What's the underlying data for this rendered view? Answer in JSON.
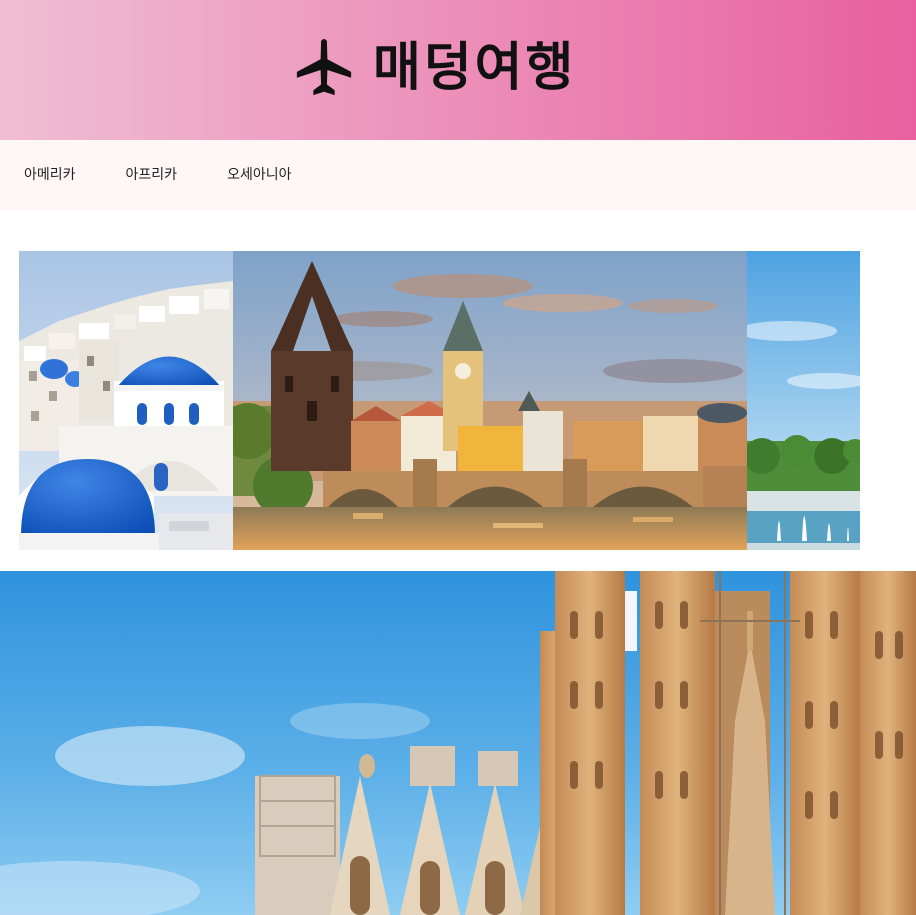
{
  "header": {
    "logo_icon": "airplane-icon",
    "title": "매덩여행",
    "colors": {
      "gradient_start": "#f0bed3",
      "gradient_end": "#e8609f"
    }
  },
  "nav": {
    "items": [
      {
        "label": "아메리카"
      },
      {
        "label": "아프리카"
      },
      {
        "label": "오세아니아"
      }
    ]
  },
  "slider": {
    "slides": [
      {
        "subject": "santorini-blue-domes"
      },
      {
        "subject": "prague-charles-bridge"
      },
      {
        "subject": "fountain-park"
      }
    ]
  },
  "hero": {
    "subject": "sagrada-familia"
  }
}
